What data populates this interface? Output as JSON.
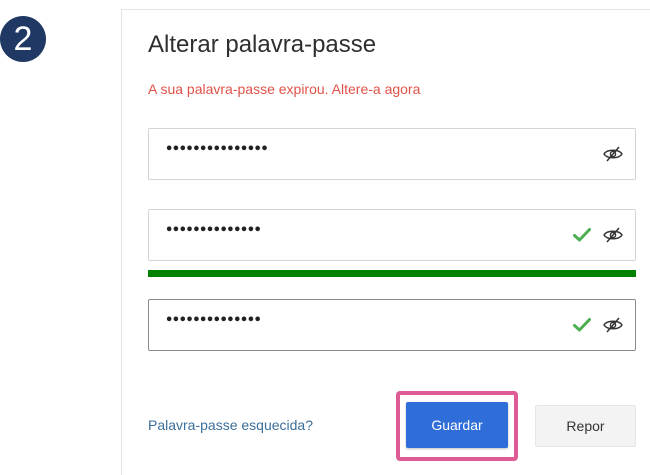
{
  "step_badge": "2",
  "form": {
    "title": "Alterar palavra-passe",
    "alert": "A sua palavra-passe expirou. Altere-a agora",
    "fields": [
      {
        "value": "•••••••••••••••",
        "valid": false
      },
      {
        "value": "••••••••••••••",
        "valid": true
      },
      {
        "value": "••••••••••••••",
        "valid": true
      }
    ],
    "strength": {
      "level": 1.0,
      "color": "#008000"
    },
    "forgot_link": "Palavra-passe esquecida?",
    "save_label": "Guardar",
    "reset_label": "Repor"
  },
  "icons": {
    "visibility": "eye-slash-icon",
    "valid": "checkmark-icon"
  },
  "colors": {
    "badge": "#1f3864",
    "alert": "#e05247",
    "accent": "#2f6ed8",
    "highlight": "#de5b96",
    "valid": "#4caf50"
  }
}
